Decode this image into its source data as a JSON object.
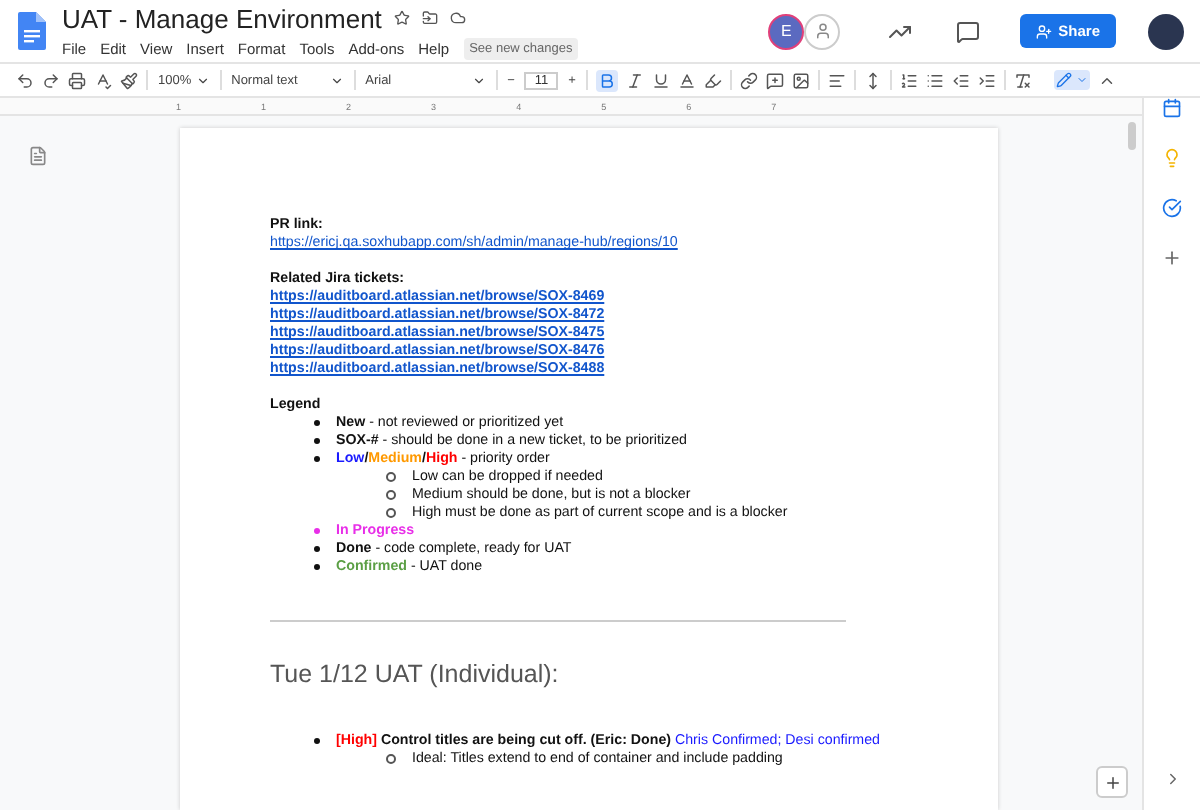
{
  "document": {
    "title": "UAT - Manage Environment",
    "menu": [
      "File",
      "Edit",
      "View",
      "Insert",
      "Format",
      "Tools",
      "Add-ons",
      "Help"
    ],
    "changes_badge": "See new changes"
  },
  "header": {
    "collaborator_initial": "E",
    "share": "Share"
  },
  "toolbar": {
    "zoom": "100%",
    "style": "Normal text",
    "font": "Arial",
    "font_size": "11",
    "minus": "−",
    "plus": "+",
    "bold_active": true
  },
  "ruler": {
    "marks": [
      "1",
      "1",
      "2",
      "3",
      "4",
      "5",
      "6",
      "7"
    ]
  },
  "body": [
    {
      "kind": "label",
      "text": "PR link:"
    },
    {
      "kind": "link",
      "text": "https://ericj.qa.soxhubapp.com/sh/admin/manage-hub/regions/10"
    },
    {
      "kind": "gap"
    },
    {
      "kind": "label",
      "text": "Related Jira tickets:"
    },
    {
      "kind": "boldlink",
      "text": "https://auditboard.atlassian.net/browse/SOX-8469"
    },
    {
      "kind": "boldlink",
      "text": "https://auditboard.atlassian.net/browse/SOX-8472"
    },
    {
      "kind": "boldlink",
      "text": "https://auditboard.atlassian.net/browse/SOX-8475"
    },
    {
      "kind": "boldlink",
      "text": "https://auditboard.atlassian.net/browse/SOX-8476"
    },
    {
      "kind": "boldlink",
      "text": "https://auditboard.atlassian.net/browse/SOX-8488"
    },
    {
      "kind": "gap"
    },
    {
      "kind": "label",
      "text": "Legend"
    },
    {
      "kind": "list",
      "items": [
        {
          "segments": [
            {
              "text": "New",
              "bold": true
            },
            {
              "text": " - not reviewed or prioritized yet"
            }
          ]
        },
        {
          "segments": [
            {
              "text": "SOX-#",
              "bold": true
            },
            {
              "text": " - should be done in a new ticket, to be prioritized"
            }
          ]
        },
        {
          "segments": [
            {
              "text": "Low",
              "bold": true,
              "color": "#1a1aff"
            },
            {
              "text": "/",
              "bold": true
            },
            {
              "text": "Medium",
              "bold": true,
              "color": "#ff9900"
            },
            {
              "text": "/",
              "bold": true
            },
            {
              "text": "High",
              "bold": true,
              "color": "#ff0000"
            },
            {
              "text": " - priority order"
            }
          ],
          "children": [
            {
              "segments": [
                {
                  "text": "Low can be dropped if needed"
                }
              ]
            },
            {
              "segments": [
                {
                  "text": "Medium should be done, but is not a blocker"
                }
              ]
            },
            {
              "segments": [
                {
                  "text": "High must be done as part of current scope and is a blocker"
                }
              ]
            }
          ]
        },
        {
          "color": "#e82ee8",
          "segments": [
            {
              "text": "In Progress",
              "bold": true,
              "color": "#e82ee8"
            }
          ]
        },
        {
          "segments": [
            {
              "text": "Done",
              "bold": true
            },
            {
              "text": " - code complete, ready for UAT"
            }
          ]
        },
        {
          "segments": [
            {
              "text": "Confirmed",
              "bold": true,
              "color": "#5b9f45"
            },
            {
              "text": " - UAT done"
            }
          ]
        }
      ]
    },
    {
      "kind": "rule"
    },
    {
      "kind": "heading",
      "text": "Tue 1/12 UAT (Individual):"
    },
    {
      "kind": "list",
      "items": [
        {
          "segments": [
            {
              "text": "[High]",
              "bold": true,
              "color": "#ff0000"
            },
            {
              "text": " Control titles are being cut off. (Eric: Done)",
              "bold": true
            },
            {
              "text": " Chris Confirmed; Desi confirmed",
              "color": "#1a1aff"
            }
          ],
          "children": [
            {
              "segments": [
                {
                  "text": "Ideal: Titles extend to end of container and include padding"
                }
              ]
            }
          ]
        }
      ]
    }
  ]
}
